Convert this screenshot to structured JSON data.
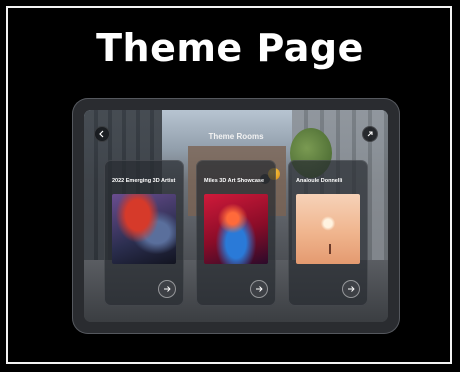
{
  "page": {
    "title": "Theme Page"
  },
  "screen": {
    "title": "Theme Rooms",
    "back_icon": "arrow-left-icon",
    "share_icon": "arrow-up-right-icon"
  },
  "cards": [
    {
      "tag": "",
      "title": "2022 Emerging 3D Artist",
      "subtitle": "",
      "art": "abstract-red-sculpture"
    },
    {
      "tag": "",
      "title": "Miles 3D Art Showcase",
      "subtitle": "",
      "art": "figure-in-red-room"
    },
    {
      "tag": "",
      "title": "Analoule Donnelli",
      "subtitle": "",
      "art": "desert-figure"
    }
  ],
  "colors": {
    "page_bg": "#000000",
    "frame": "#f2f2f2",
    "tablet": "#2a2c30"
  }
}
